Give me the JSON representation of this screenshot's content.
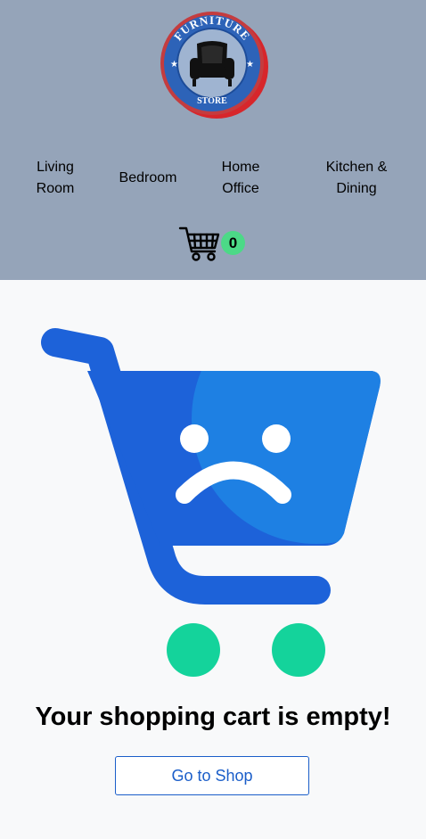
{
  "logo": {
    "top_text": "FURNITURE",
    "bottom_text": "STORE",
    "icon": "armchair-logo"
  },
  "nav": {
    "items": [
      {
        "line1": "Living",
        "line2": "Room"
      },
      {
        "line1": "Bedroom",
        "line2": ""
      },
      {
        "line1": "Home",
        "line2": "Office"
      },
      {
        "line1": "Kitchen &",
        "line2": "Dining"
      }
    ]
  },
  "cart": {
    "icon": "shopping-cart-icon",
    "count": "0"
  },
  "empty_state": {
    "illustration": "sad-cart-illustration",
    "message": "Your shopping cart is empty!",
    "button_label": "Go to Shop"
  },
  "colors": {
    "header_bg": "#95a4b9",
    "page_bg": "#f8f9fa",
    "cart_blue": "#1d62d9",
    "cart_light_blue": "#1e80e3",
    "wheel_green": "#14d39b",
    "badge_green": "#4cd987",
    "button_blue": "#1b5ec9"
  }
}
